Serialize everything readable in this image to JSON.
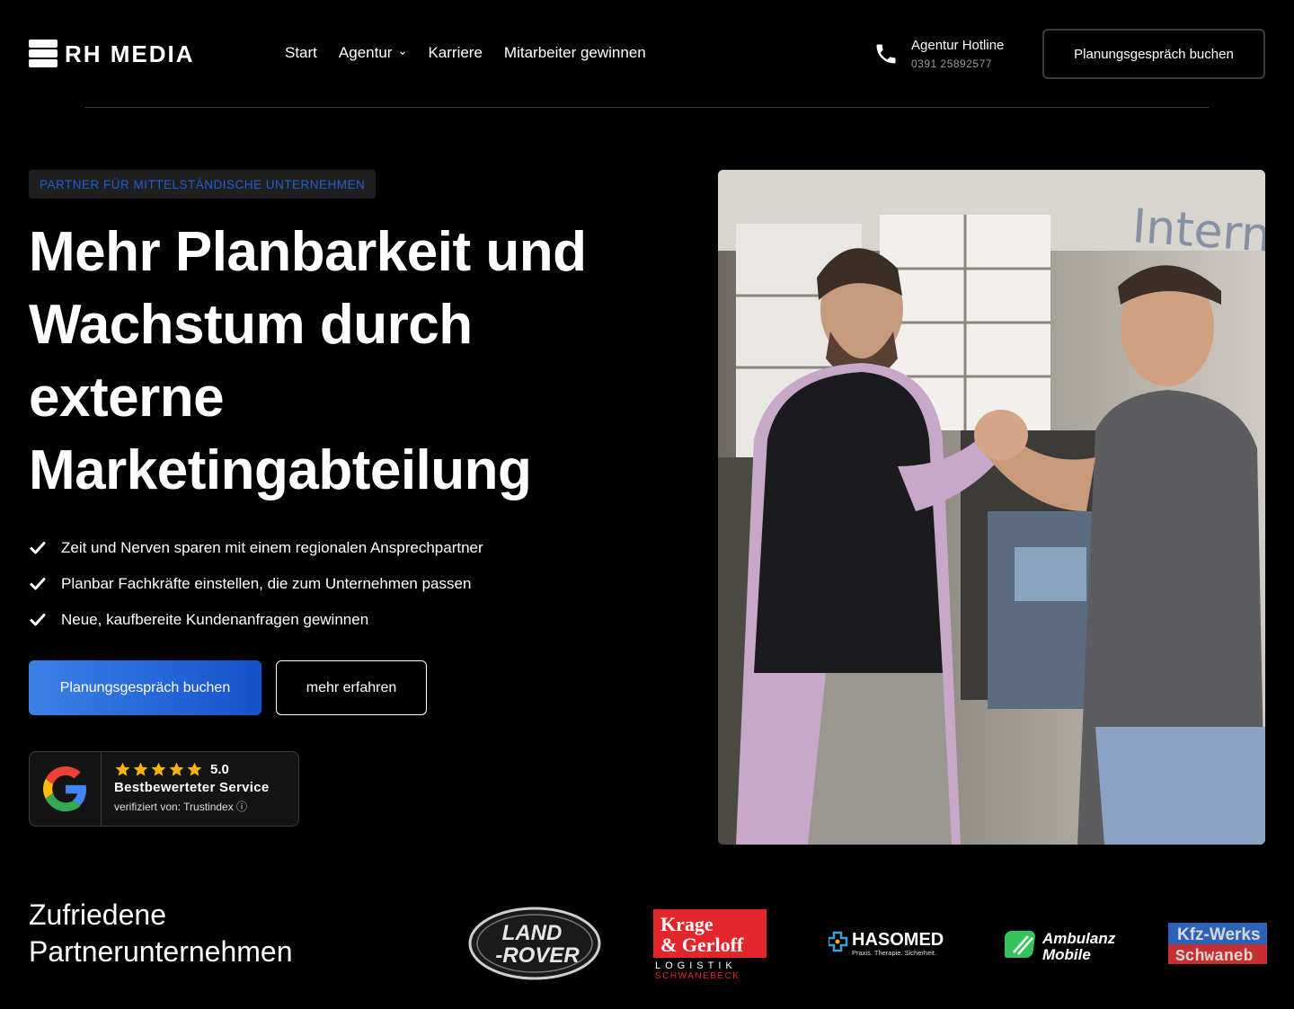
{
  "brand": {
    "name": "RH MEDIA"
  },
  "nav": {
    "items": [
      {
        "label": "Start"
      },
      {
        "label": "Agentur"
      },
      {
        "label": "Karriere"
      },
      {
        "label": "Mitarbeiter gewinnen"
      }
    ]
  },
  "hotline": {
    "title": "Agentur Hotline",
    "number": "0391 25892577"
  },
  "header_cta": "Planungsgespräch buchen",
  "hero": {
    "badge": "PARTNER FÜR MITTELSTÄNDISCHE UNTERNEHMEN",
    "title": "Mehr Planbarkeit und Wachstum durch externe Marketingabteilung",
    "bullets": [
      "Zeit und Nerven sparen mit einem regionalen Ansprechpartner",
      "Planbar Fachkräfte einstellen, die zum Unternehmen passen",
      "Neue, kaufbereite Kundenanfragen gewinnen"
    ],
    "primary_cta": "Planungsgespräch buchen",
    "secondary_cta": "mehr erfahren"
  },
  "review": {
    "rating": "5.0",
    "rating_value": 5,
    "title": "Bestbewerteter Service",
    "verified": "verifiziert von: Trustindex ⓘ"
  },
  "partners": {
    "title_line1": "Zufriedene",
    "title_line2": "Partnerunternehmen",
    "logos": [
      {
        "name": "LAND ROVER",
        "line1": "LAND",
        "line2": "-ROVER"
      },
      {
        "name": "Krage & Gerloff",
        "line1": "Krage",
        "line2": "& Gerloff",
        "sub1": "LOGISTIK",
        "sub2": "SCHWANEBECK"
      },
      {
        "name": "HASOMED",
        "line1": "HASOMED",
        "sub1": "Praxis. Therapie. Sicherheit."
      },
      {
        "name": "Ambulanz Mobile",
        "line1": "Ambulanz",
        "line2": "Mobile"
      },
      {
        "name": "Kfz-Werkstatt Schwanebeck",
        "line1": "Kfz-Werks",
        "line2": "Schwaneb"
      }
    ]
  },
  "colors": {
    "accent": "#1d5fd1",
    "button_gradient_start": "#3b82e6",
    "button_gradient_end": "#1452cc",
    "star": "#f4b400"
  }
}
